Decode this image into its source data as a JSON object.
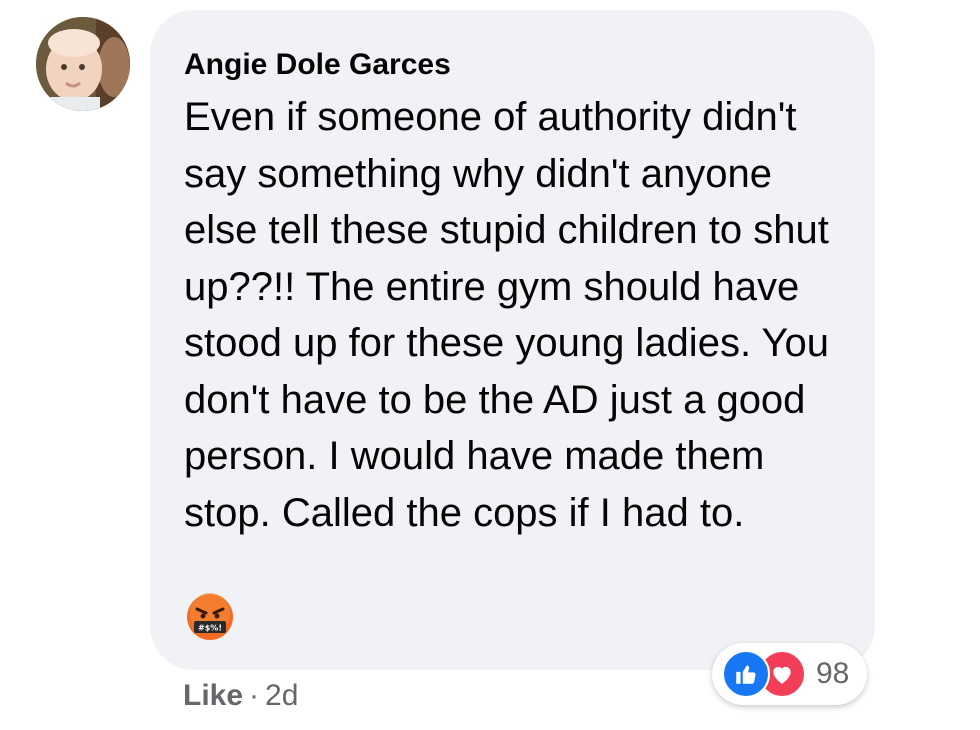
{
  "comment": {
    "author": "Angie Dole Garces",
    "text": "Even if someone of authority didn't say something why didn't anyone else tell these stupid children to shut up??!! The entire gym should have stood up for these young ladies. You don't have to be the AD just a good person. I would have made them stop. Called the cops if I had to.",
    "emoji": "angry-face-with-symbols-icon"
  },
  "footer": {
    "like_label": "Like",
    "separator": "·",
    "time": "2d"
  },
  "reactions": {
    "icons": [
      "like-reaction-icon",
      "love-reaction-icon"
    ],
    "count": "98"
  },
  "colors": {
    "bubble": "#f0f2f5",
    "text": "#050505",
    "secondary": "#65676b",
    "like_blue": "#1877f2",
    "love_red": "#f33e58"
  }
}
